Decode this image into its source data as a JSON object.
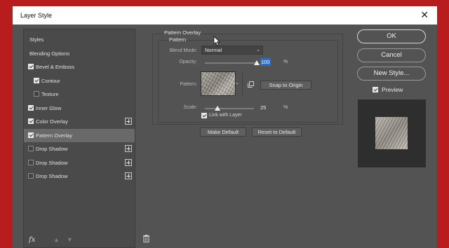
{
  "window": {
    "title": "Layer Style",
    "close_glyph": "✕"
  },
  "sidebar": {
    "items": [
      {
        "label": "Styles",
        "checkbox": false,
        "checked": false,
        "indent": false,
        "plus": false,
        "selected": false
      },
      {
        "label": "Blending Options",
        "checkbox": false,
        "checked": false,
        "indent": false,
        "plus": false,
        "selected": false
      },
      {
        "label": "Bevel & Emboss",
        "checkbox": true,
        "checked": true,
        "indent": false,
        "plus": false,
        "selected": false
      },
      {
        "label": "Contour",
        "checkbox": true,
        "checked": true,
        "indent": true,
        "plus": false,
        "selected": false
      },
      {
        "label": "Texture",
        "checkbox": true,
        "checked": false,
        "indent": true,
        "plus": false,
        "selected": false
      },
      {
        "label": "Inner Glow",
        "checkbox": true,
        "checked": true,
        "indent": false,
        "plus": false,
        "selected": false
      },
      {
        "label": "Color Overlay",
        "checkbox": true,
        "checked": true,
        "indent": false,
        "plus": true,
        "selected": false
      },
      {
        "label": "Pattern Overlay",
        "checkbox": true,
        "checked": true,
        "indent": false,
        "plus": false,
        "selected": true
      },
      {
        "label": "Drop Shadow",
        "checkbox": true,
        "checked": false,
        "indent": false,
        "plus": true,
        "selected": false
      },
      {
        "label": "Drop Shadow",
        "checkbox": true,
        "checked": false,
        "indent": false,
        "plus": true,
        "selected": false
      },
      {
        "label": "Drop Shadow",
        "checkbox": true,
        "checked": false,
        "indent": false,
        "plus": true,
        "selected": false
      }
    ],
    "fx_label": "fx"
  },
  "pattern_overlay": {
    "section_title": "Pattern Overlay",
    "subsection_title": "Pattern",
    "blend_mode_label": "Blend Mode:",
    "blend_mode_value": "Normal",
    "opacity_label": "Opacity:",
    "opacity_value": "100",
    "opacity_fraction": 1.0,
    "opacity_unit": "%",
    "pattern_label": "Pattern:",
    "snap_button": "Snap to Origin",
    "scale_label": "Scale:",
    "scale_value": "25",
    "scale_fraction": 0.25,
    "scale_unit": "%",
    "link_with_layer_label": "Link with Layer",
    "link_with_layer_checked": true,
    "make_default_button": "Make Default",
    "reset_default_button": "Reset to Default"
  },
  "actions": {
    "ok": "OK",
    "cancel": "Cancel",
    "new_style": "New Style...",
    "preview_label": "Preview",
    "preview_checked": true
  },
  "colors": {
    "background_red": "#b81c1c",
    "dialog_gray": "#535353",
    "selection_gray": "#696969",
    "highlight_blue": "#2f6ec7"
  }
}
